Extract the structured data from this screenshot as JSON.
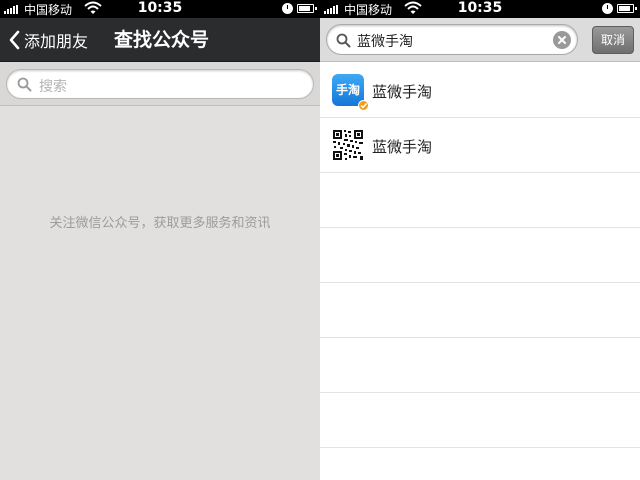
{
  "status": {
    "carrier": "中国移动",
    "time": "10:35"
  },
  "left": {
    "nav": {
      "back_label": "添加朋友",
      "title": "查找公众号"
    },
    "search": {
      "placeholder": "搜索"
    },
    "hint": "关注微信公众号，获取更多服务和资讯"
  },
  "right": {
    "search": {
      "query": "蓝微手淘",
      "cancel_label": "取消"
    },
    "results": [
      {
        "label": "蓝微手淘",
        "icon": "shoutao-app-icon",
        "verified": true,
        "logo_text": "手淘"
      },
      {
        "label": "蓝微手淘",
        "icon": "qr-code-icon",
        "verified": false
      }
    ]
  },
  "colors": {
    "navbar": "#2a2c2e",
    "left_background": "#e1e0de",
    "verified_badge": "#f39c1a",
    "app_icon": "#1e86e0"
  }
}
